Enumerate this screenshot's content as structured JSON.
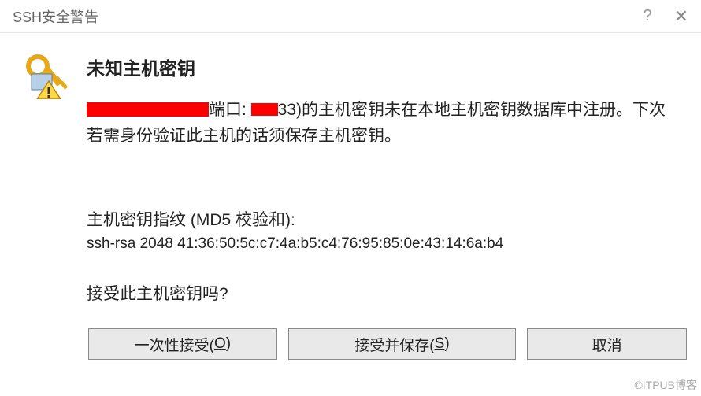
{
  "titlebar": {
    "title": "SSH安全警告",
    "help": "?",
    "close": "✕"
  },
  "dialog": {
    "heading": "未知主机密钥",
    "port_label": "端口: ",
    "port_value_partial": "33",
    "desc_tail": ")的主机密钥未在本地主机密钥数据库中注册。下次若需身份验证此主机的话须保存主机密钥。",
    "fingerprint_label": "主机密钥指纹 (MD5 校验和):",
    "fingerprint_value": "ssh-rsa 2048 41:36:50:5c:c7:4a:b5:c4:76:95:85:0e:43:14:6a:b4",
    "question": "接受此主机密钥吗?"
  },
  "buttons": {
    "accept_once": "一次性接受(",
    "accept_once_key": "O",
    "accept_once_tail": ")",
    "accept_save": "接受并保存(",
    "accept_save_key": "S",
    "accept_save_tail": ")",
    "cancel": "取消"
  },
  "watermark": "©ITPUB博客"
}
